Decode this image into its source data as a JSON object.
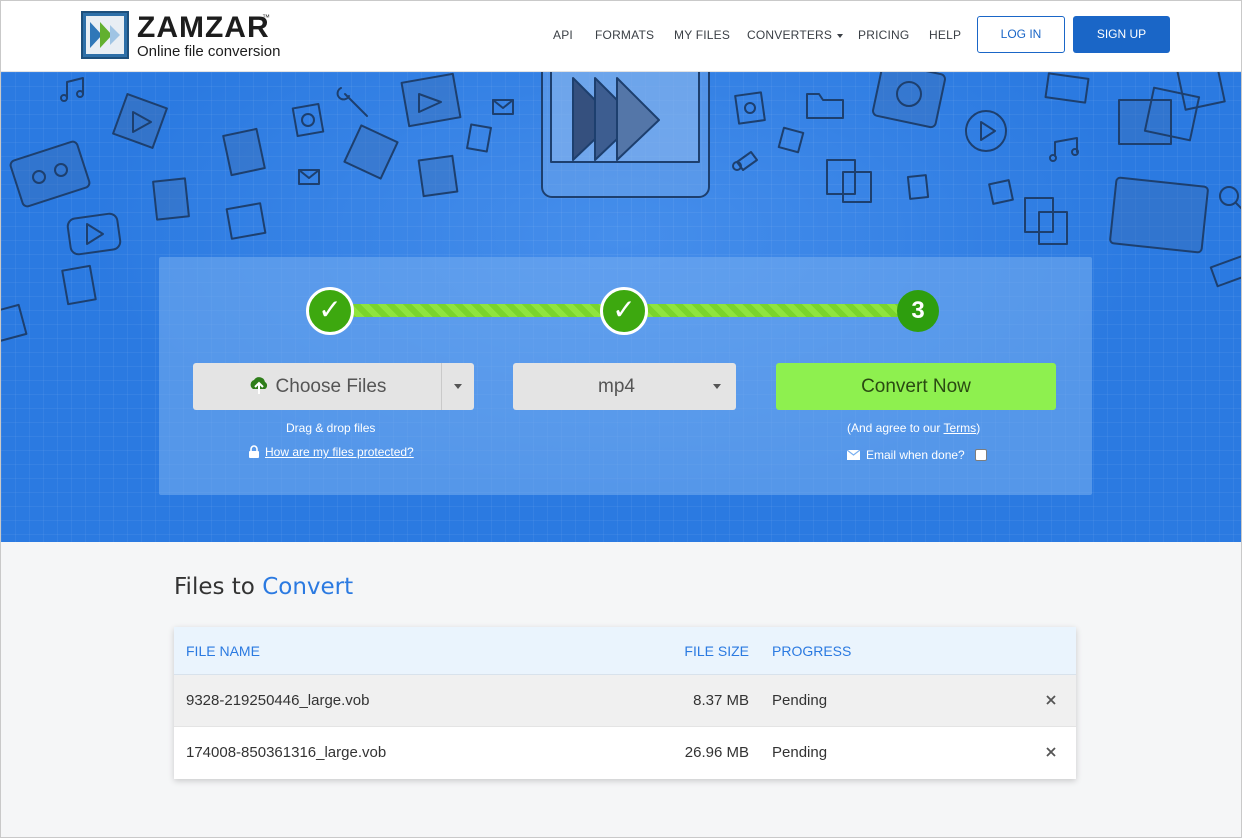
{
  "header": {
    "logo_word": "ZAMZAR",
    "logo_tm": "™",
    "logo_tagline": "Online file conversion",
    "nav": [
      {
        "label": "API"
      },
      {
        "label": "FORMATS"
      },
      {
        "label": "MY FILES"
      },
      {
        "label": "CONVERTERS",
        "has_dropdown": true
      },
      {
        "label": "PRICING"
      },
      {
        "label": "HELP"
      }
    ],
    "login_label": "LOG IN",
    "signup_label": "SIGN UP"
  },
  "converter": {
    "steps": [
      {
        "state": "done",
        "symbol": "✓"
      },
      {
        "state": "done",
        "symbol": "✓"
      },
      {
        "state": "current",
        "symbol": "3"
      }
    ],
    "choose_files_label": "Choose Files",
    "drag_drop_text": "Drag & drop files",
    "protected_link": "How are my files protected?",
    "format_value": "mp4",
    "convert_label": "Convert Now",
    "agree_prefix": "(And agree to our ",
    "agree_link": "Terms",
    "agree_suffix": ")",
    "email_label": "Email when done?",
    "email_checked": false
  },
  "files": {
    "title_part1": "Files to ",
    "title_part2": "Convert",
    "columns": {
      "name": "FILE NAME",
      "size": "FILE SIZE",
      "progress": "PROGRESS"
    },
    "rows": [
      {
        "name": "9328-219250446_large.vob",
        "size": "8.37 MB",
        "progress": "Pending"
      },
      {
        "name": "174008-850361316_large.vob",
        "size": "26.96 MB",
        "progress": "Pending"
      }
    ]
  },
  "colors": {
    "brand_blue": "#1a66c7",
    "hero_blue": "#2b7ae1",
    "step_green": "#3da80f",
    "convert_green": "#8ef04f"
  }
}
